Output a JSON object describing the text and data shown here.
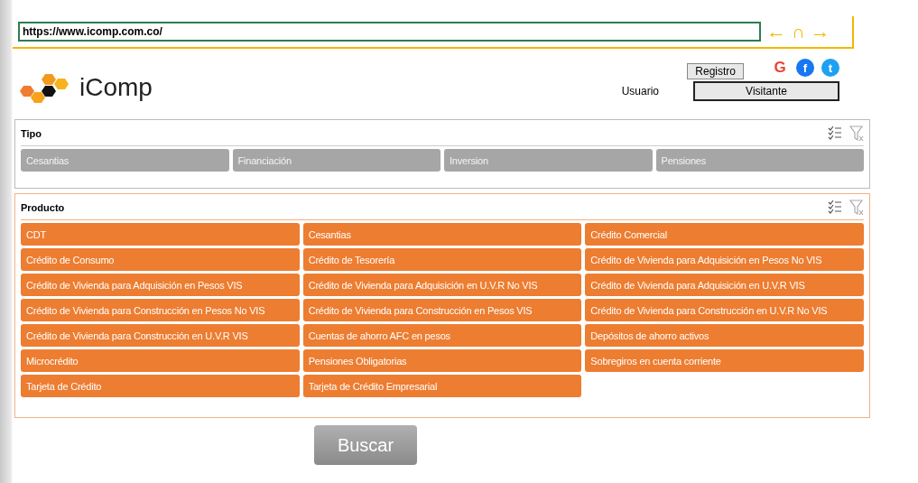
{
  "address_bar": {
    "url": "https://www.icomp.com.co/"
  },
  "nav": [
    {
      "kind": "back",
      "glyph": "←"
    },
    {
      "kind": "home",
      "glyph": "∩"
    },
    {
      "kind": "forward",
      "glyph": "→"
    }
  ],
  "brand": {
    "name": "iComp"
  },
  "user": {
    "register_button": "Registro",
    "label": "Usuario",
    "value": "Visitante"
  },
  "social": [
    {
      "kind": "google",
      "glyph": "G",
      "color": "#ea4335"
    },
    {
      "kind": "facebook",
      "glyph": "f",
      "color": "#1877f2"
    },
    {
      "kind": "twitter",
      "glyph": "t",
      "color": "#1da1f2"
    }
  ],
  "slicers": [
    {
      "title": "Tipo",
      "items": [
        {
          "label": "Cesantias",
          "selected": false
        },
        {
          "label": "Financiación",
          "selected": false
        },
        {
          "label": "Inversion",
          "selected": false
        },
        {
          "label": "Pensiones",
          "selected": false
        }
      ]
    },
    {
      "title": "Producto",
      "items": [
        {
          "label": "CDT",
          "selected": true
        },
        {
          "label": "Cesantias",
          "selected": true
        },
        {
          "label": "Crédito Comercial",
          "selected": true
        },
        {
          "label": "Crédito de Consumo",
          "selected": true
        },
        {
          "label": "Crédito de Tesorería",
          "selected": true
        },
        {
          "label": "Crédito de Vivienda para Adquisición en Pesos No VIS",
          "selected": true
        },
        {
          "label": "Crédito de Vivienda para Adquisición en Pesos VIS",
          "selected": true
        },
        {
          "label": "Crédito de Vivienda para Adquisición en U.V.R No VIS",
          "selected": true
        },
        {
          "label": "Crédito de Vivienda para Adquisición en U.V.R VIS",
          "selected": true
        },
        {
          "label": "Crédito de Vivienda para Construcción en Pesos No VIS",
          "selected": true
        },
        {
          "label": "Crédito de Vivienda para Construcción en Pesos VIS",
          "selected": true
        },
        {
          "label": "Crédito de Vivienda para Construcción en U.V.R No VIS",
          "selected": true
        },
        {
          "label": "Crédito de Vivienda para Construcción en U.V.R VIS",
          "selected": true
        },
        {
          "label": "Cuentas de ahorro AFC en pesos",
          "selected": true
        },
        {
          "label": "Depósitos de ahorro activos",
          "selected": true
        },
        {
          "label": "Microcrédito",
          "selected": true
        },
        {
          "label": "Pensiones Obligatorias",
          "selected": true
        },
        {
          "label": "Sobregiros en cuenta corriente",
          "selected": true
        },
        {
          "label": "Tarjeta de Crédito",
          "selected": true
        },
        {
          "label": "Tarjeta de Crédito Empresarial",
          "selected": true
        }
      ]
    }
  ],
  "search_button": "Buscar"
}
